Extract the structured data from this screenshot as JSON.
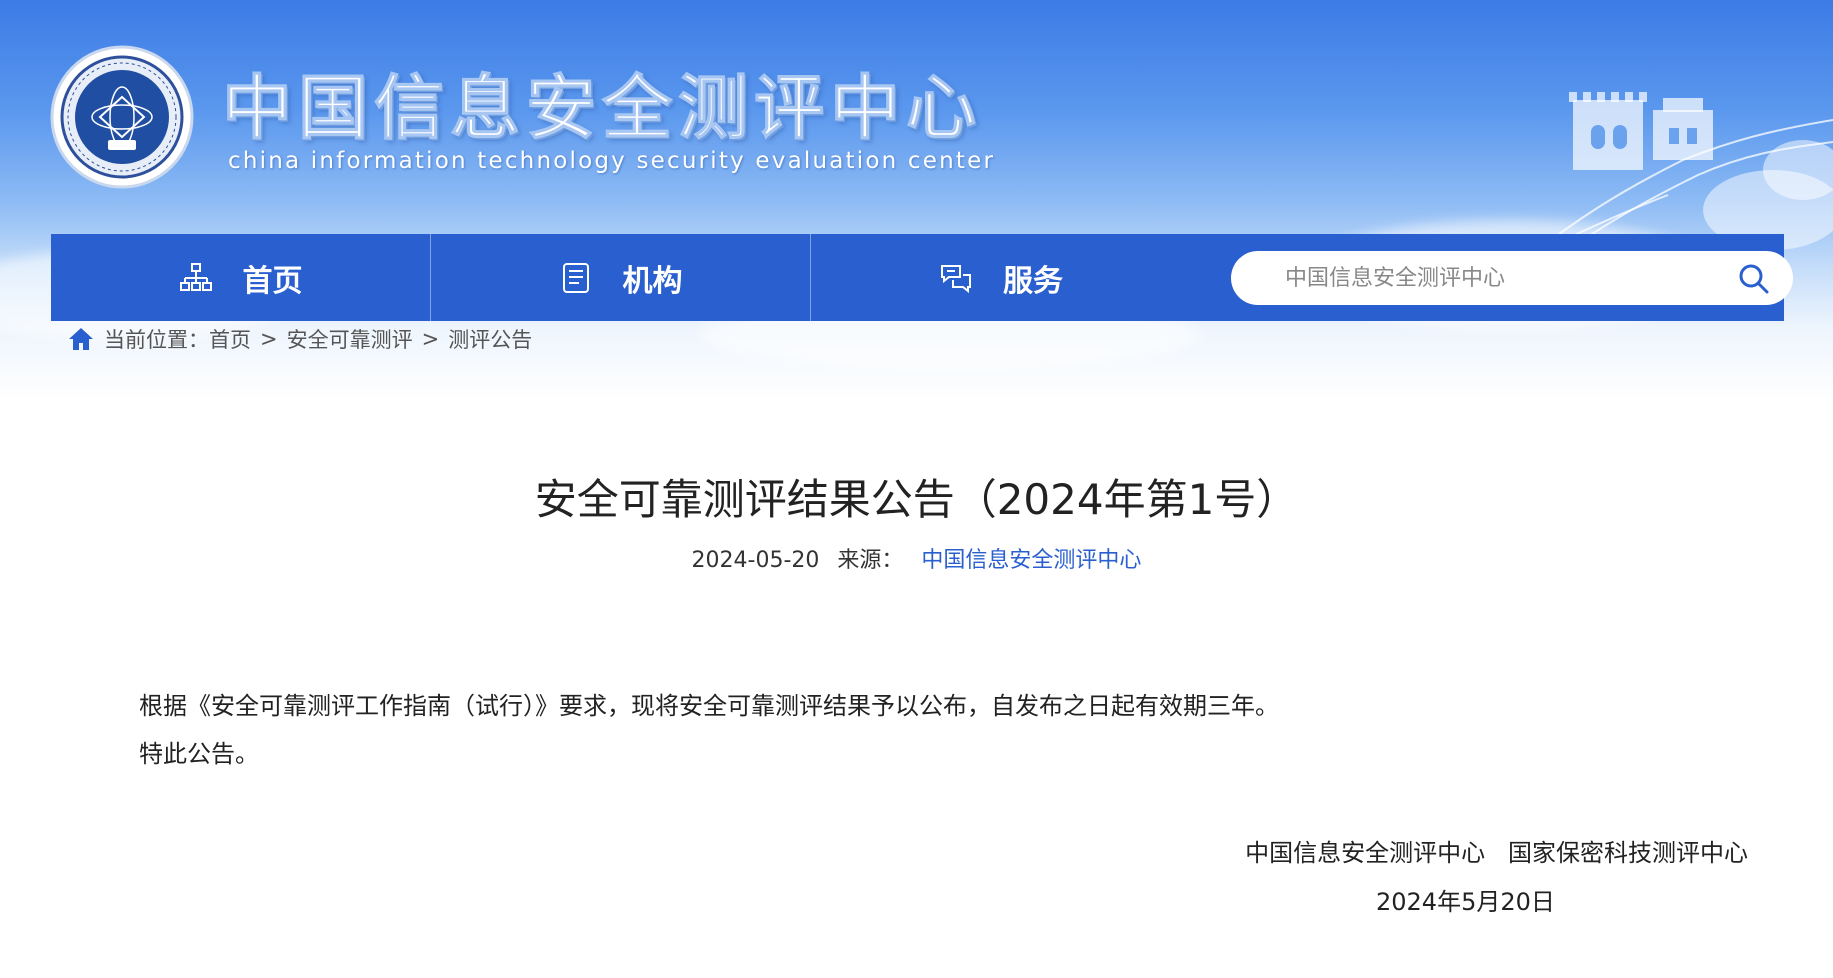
{
  "header": {
    "site_title": "中国信息安全测评中心",
    "site_subtitle": "china information technology security evaluation center",
    "logo_icon": "cnitsec-emblem-icon"
  },
  "nav": {
    "items": [
      {
        "label": "首页",
        "icon": "sitemap-icon"
      },
      {
        "label": "机构",
        "icon": "document-list-icon"
      },
      {
        "label": "服务",
        "icon": "service-chat-icon"
      }
    ],
    "search": {
      "placeholder": "中国信息安全测评中心",
      "icon": "search-icon"
    }
  },
  "breadcrumb": {
    "prefix": "当前位置：",
    "items": [
      "首页",
      "安全可靠测评",
      "测评公告"
    ],
    "separator": ">"
  },
  "article": {
    "title": "安全可靠测评结果公告（2024年第1号）",
    "date": "2024-05-20",
    "source_label": "来源：",
    "source": "中国信息安全测评中心",
    "paragraphs": [
      "根据《安全可靠测评工作指南（试行）》要求，现将安全可靠测评结果予以公布，自发布之日起有效期三年。",
      "特此公告。"
    ],
    "signature": "中国信息安全测评中心   国家保密科技测评中心",
    "signature_date": "2024年5月20日"
  },
  "colors": {
    "nav_bg": "#2a5fcf",
    "link": "#2a5fcf",
    "banner_top": "#3c7be6"
  }
}
